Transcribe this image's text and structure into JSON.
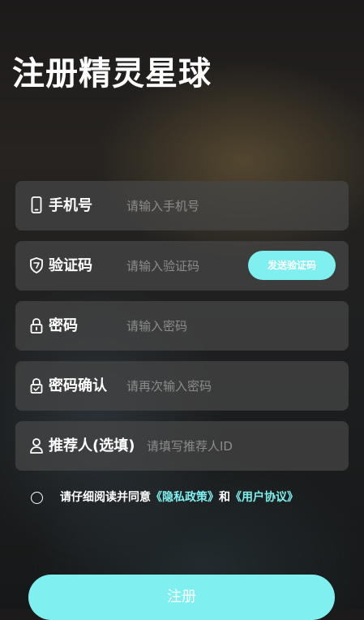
{
  "page": {
    "title": "注册精灵星球"
  },
  "form": {
    "phone": {
      "icon": "phone-icon",
      "label": "手机号",
      "placeholder": "请输入手机号",
      "value": ""
    },
    "code": {
      "icon": "shield-icon",
      "label": "验证码",
      "placeholder": "请输入验证码",
      "value": "",
      "send_label": "发送验证码"
    },
    "password": {
      "icon": "lock-icon",
      "label": "密码",
      "placeholder": "请输入密码",
      "value": ""
    },
    "confirm": {
      "icon": "lock-check-icon",
      "label": "密码确认",
      "placeholder": "请再次输入密码",
      "value": ""
    },
    "referrer": {
      "icon": "user-icon",
      "label": "推荐人(选填)",
      "placeholder": "请填写推荐人ID",
      "value": ""
    }
  },
  "agreement": {
    "prefix": "请仔细阅读并同意",
    "privacy_link": "《隐私政策》",
    "joiner": "和",
    "terms_link": "《用户协议》",
    "checked": false
  },
  "submit_label": "注册",
  "colors": {
    "accent": "#7ff0ef",
    "field_bg": "#464646",
    "placeholder": "#8c8c8c"
  }
}
